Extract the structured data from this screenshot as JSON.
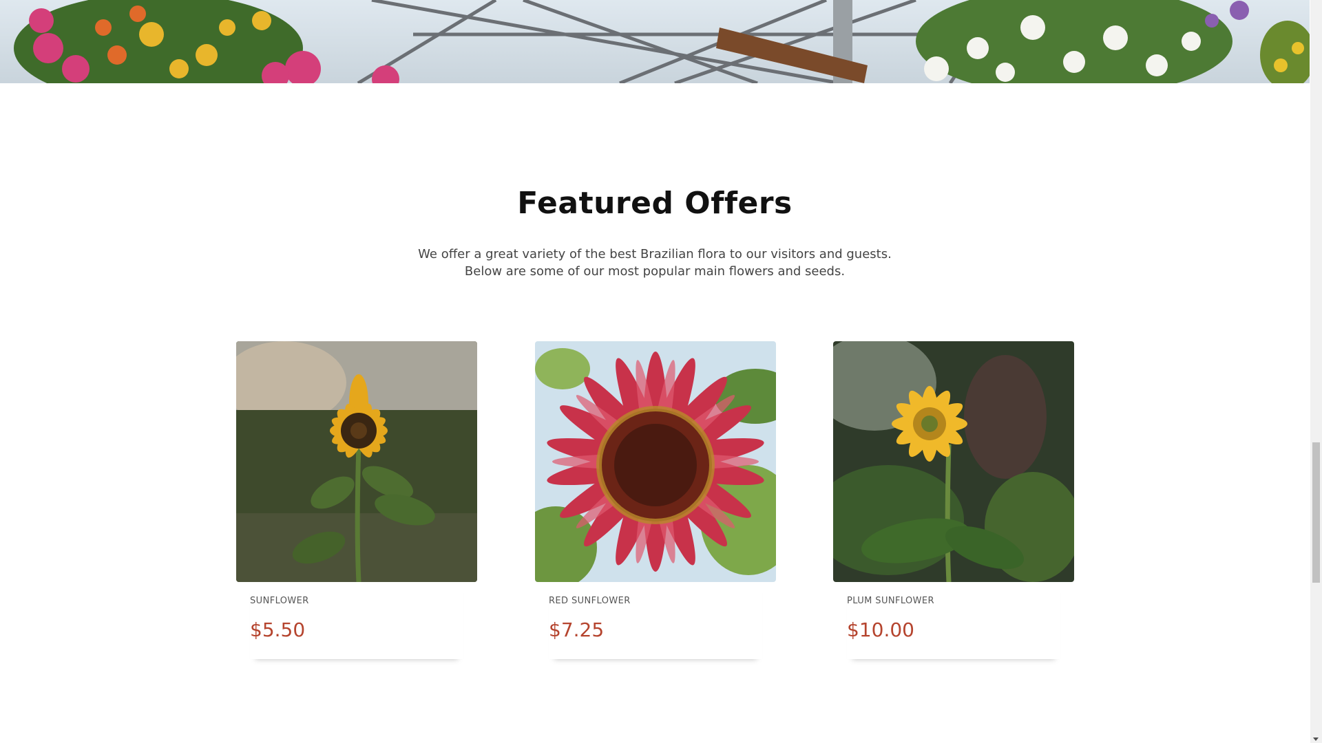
{
  "hero": {
    "image": "greenhouse-hanging-flower-baskets"
  },
  "featured": {
    "title": "Featured Offers",
    "description_lines": [
      "We offer a great variety of the best Brazilian flora to our visitors and guests.",
      "Below are some of our most popular main flowers and seeds."
    ]
  },
  "products": [
    {
      "name": "SUNFLOWER",
      "price": "$5.50",
      "image": "sunflower-photo"
    },
    {
      "name": "RED SUNFLOWER",
      "price": "$7.25",
      "image": "red-sunflower-photo"
    },
    {
      "name": "PLUM SUNFLOWER",
      "price": "$10.00",
      "image": "plum-sunflower-photo"
    }
  ],
  "colors": {
    "price": "#b5442e",
    "title": "#111111",
    "text": "#444444"
  }
}
